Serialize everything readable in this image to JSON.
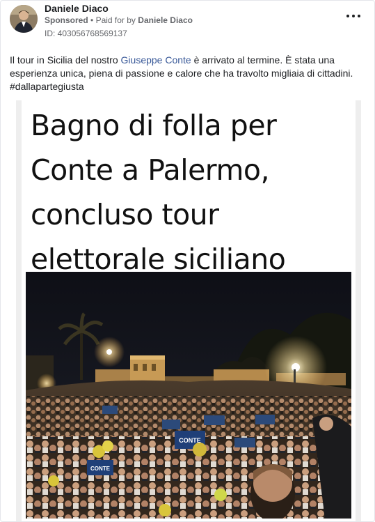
{
  "post": {
    "author": "Daniele Diaco",
    "sponsored_label": "Sponsored",
    "paid_for_prefix": "Paid for by",
    "paid_for_name": "Daniele Diaco",
    "ad_id": "ID: 403056768569137",
    "text_before_link": "Il tour in Sicilia del nostro ",
    "link_text": "Giuseppe Conte",
    "text_after_link": " è arrivato al termine. È stata una esperienza unica, piena di passione e calore che ha travolto migliaia di cittadini. #dallapartegiusta"
  },
  "media": {
    "headline_lines": [
      "Bagno di folla per",
      "Conte a Palermo,",
      "concluso tour",
      "elettorale siciliano"
    ],
    "sign_text_1": "CONTE",
    "sign_text_2": "CONTE"
  },
  "icons": {
    "more": "more-horizontal-icon"
  },
  "colors": {
    "link": "#385898",
    "secondary_text": "#65676b",
    "night_sky": "#0d0d14"
  }
}
